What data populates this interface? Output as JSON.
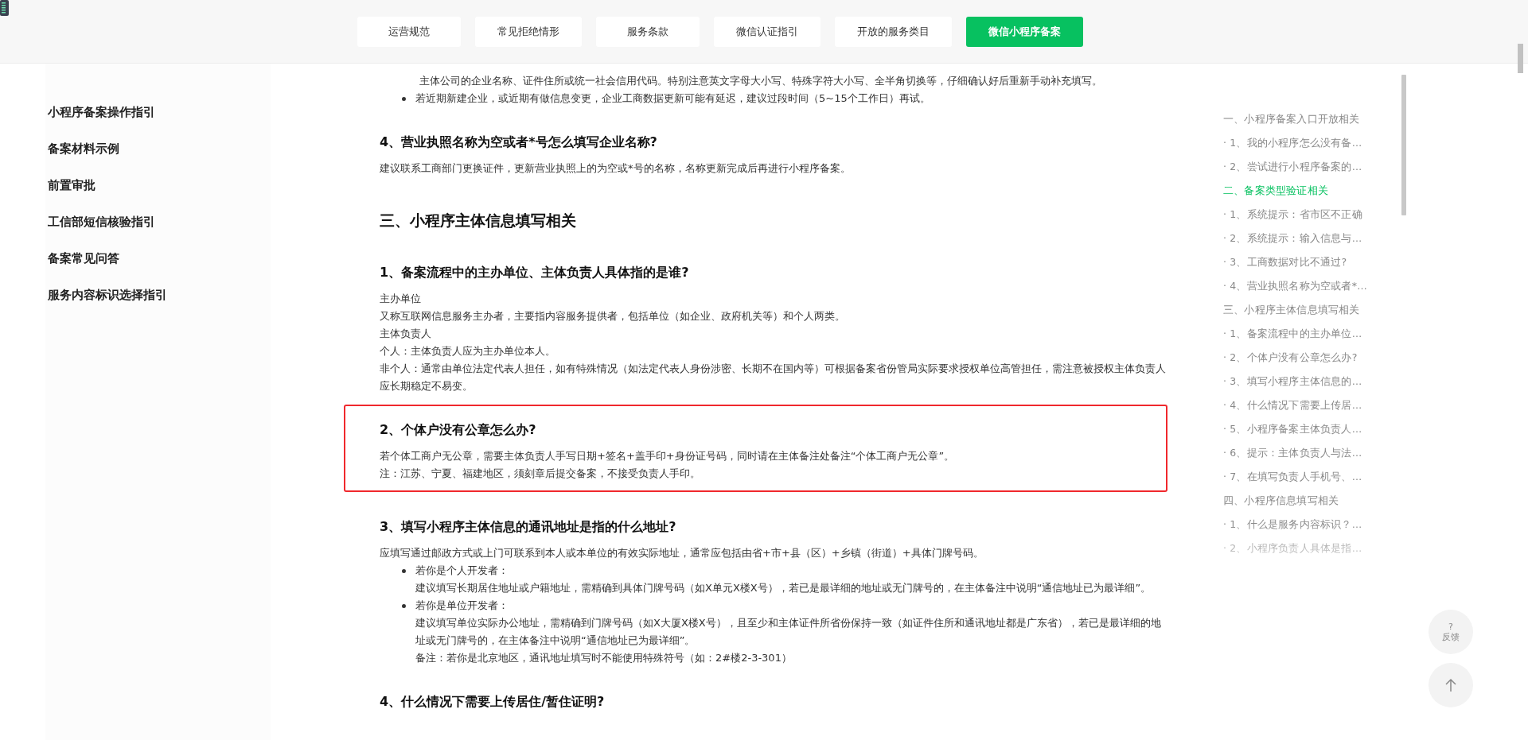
{
  "header": {
    "nav": [
      {
        "label": "运营规范",
        "kind": "default"
      },
      {
        "label": "常见拒绝情形",
        "kind": "default"
      },
      {
        "label": "服务条款",
        "kind": "default"
      },
      {
        "label": "微信认证指引",
        "kind": "default"
      },
      {
        "label": "开放的服务类目",
        "kind": "default"
      },
      {
        "label": "微信小程序备案",
        "kind": "primary"
      }
    ]
  },
  "sidebar": {
    "items": [
      "小程序备案操作指引",
      "备案材料示例",
      "前置审批",
      "工信部短信核验指引",
      "备案常见问答",
      "服务内容标识选择指引"
    ]
  },
  "article": {
    "blocks": [
      {
        "kind": "continuation",
        "text": "主体公司的企业名称、证件住所或统一社会信用代码。特别注意英文字母大小写、特殊字符大小写、全半角切换等，仔细确认好后重新手动补充填写。"
      },
      {
        "kind": "bullet",
        "lines": [
          "若近期新建企业，或近期有做信息变更，企业工商数据更新可能有延迟，建议过段时间（5~15个工作日）再试。"
        ]
      },
      {
        "kind": "question",
        "text": "4、营业执照名称为空或者*号怎么填写企业名称?"
      },
      {
        "kind": "paragraph",
        "text": "建议联系工商部门更换证件，更新营业执照上的为空或*号的名称，名称更新完成后再进行小程序备案。"
      },
      {
        "kind": "section",
        "text": "三、小程序主体信息填写相关"
      },
      {
        "kind": "question",
        "text": "1、备案流程中的主办单位、主体负责人具体指的是谁?"
      },
      {
        "kind": "paragraph",
        "text": "主办单位"
      },
      {
        "kind": "paragraph",
        "text": "又称互联网信息服务主办者，主要指内容服务提供者，包括单位（如企业、政府机关等）和个人两类。"
      },
      {
        "kind": "paragraph",
        "text": "主体负责人"
      },
      {
        "kind": "paragraph",
        "text": "个人：主体负责人应为主办单位本人。"
      },
      {
        "kind": "paragraph",
        "text": "非个人：通常由单位法定代表人担任，如有特殊情况（如法定代表人身份涉密、长期不在国内等）可根据备案省份管局实际要求授权单位高管担任，需注意被授权主体负责人应长期稳定不易变。"
      },
      {
        "kind": "highlight",
        "blocks": [
          {
            "kind": "question",
            "text": "2、个体户没有公章怎么办?"
          },
          {
            "kind": "paragraph",
            "text": "若个体工商户无公章，需要主体负责人手写日期+签名+盖手印+身份证号码，同时请在主体备注处备注“个体工商户无公章”。"
          },
          {
            "kind": "paragraph",
            "text": "注：江苏、宁夏、福建地区，须刻章后提交备案，不接受负责人手印。"
          }
        ]
      },
      {
        "kind": "question",
        "text": "3、填写小程序主体信息的通讯地址是指的什么地址?"
      },
      {
        "kind": "paragraph",
        "text": "应填写通过邮政方式或上门可联系到本人或本单位的有效实际地址，通常应包括由省+市+县（区）+乡镇（街道）+具体门牌号码。"
      },
      {
        "kind": "bullet",
        "lines": [
          "若你是个人开发者：",
          "建议填写长期居住地址或户籍地址，需精确到具体门牌号码（如X单元X楼X号），若已是最详细的地址或无门牌号的，在主体备注中说明“通信地址已为最详细”。"
        ]
      },
      {
        "kind": "bullet",
        "lines": [
          "若你是单位开发者：",
          "建议填写单位实际办公地址，需精确到门牌号码（如X大厦X楼X号），且至少和主体证件所省份保持一致（如证件住所和通讯地址都是广东省），若已是最详细的地址或无门牌号的，在主体备注中说明“通信地址已为最详细”。",
          "备注：若你是北京地区，通讯地址填写时不能使用特殊符号（如：2#楼2-3-301）"
        ]
      },
      {
        "kind": "question",
        "text": "4、什么情况下需要上传居住/暂住证明?"
      }
    ]
  },
  "toc": {
    "sections": [
      {
        "title": "一、小程序备案入口开放相关",
        "selected": false,
        "children": [
          {
            "label": "· 1、我的小程序怎么没有备…",
            "selected": false
          },
          {
            "label": "· 2、尝试进行小程序备案的…",
            "selected": false
          }
        ]
      },
      {
        "title": "二、备案类型验证相关",
        "selected": true,
        "children": [
          {
            "label": "· 1、系统提示：省市区不正确",
            "selected": false
          },
          {
            "label": "· 2、系统提示：输入信息与…",
            "selected": false
          },
          {
            "label": "· 3、工商数据对比不通过?",
            "selected": false
          },
          {
            "label": "· 4、营业执照名称为空或者*…",
            "selected": false
          }
        ]
      },
      {
        "title": "三、小程序主体信息填写相关",
        "selected": false,
        "children": [
          {
            "label": "· 1、备案流程中的主办单位…",
            "selected": false
          },
          {
            "label": "· 2、个体户没有公章怎么办?",
            "selected": false
          },
          {
            "label": "· 3、填写小程序主体信息的…",
            "selected": false
          },
          {
            "label": "· 4、什么情况下需要上传居…",
            "selected": false
          },
          {
            "label": "· 5、小程序备案主体负责人…",
            "selected": false
          },
          {
            "label": "· 6、提示：主体负责人与法…",
            "selected": false
          },
          {
            "label": "· 7、在填写负责人手机号、…",
            "selected": false
          }
        ]
      },
      {
        "title": "四、小程序信息填写相关",
        "selected": false,
        "children": [
          {
            "label": "· 1、什么是服务内容标识？…",
            "selected": false
          },
          {
            "label": "· 2、小程序负责人具体是指…",
            "selected": false
          }
        ]
      }
    ]
  },
  "float": {
    "feedback": {
      "mark": "?",
      "label": "反馈"
    }
  }
}
